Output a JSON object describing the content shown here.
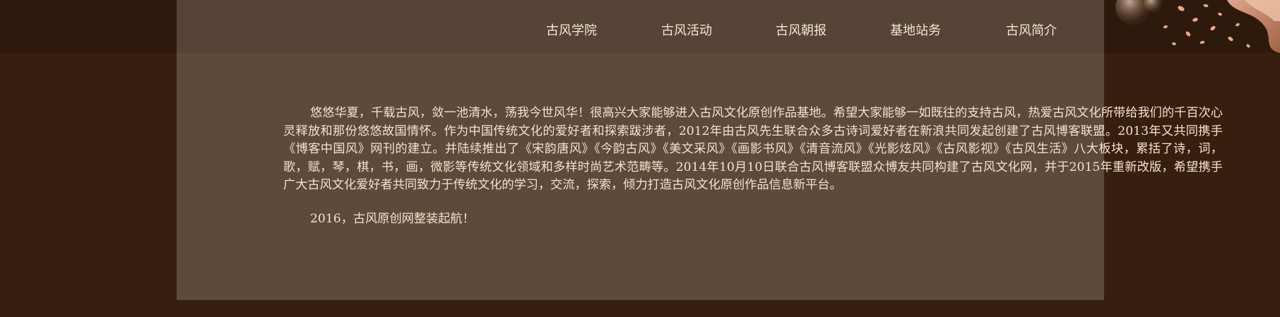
{
  "nav": {
    "items": [
      {
        "label": "古风学院"
      },
      {
        "label": "古风活动"
      },
      {
        "label": "古风朝报"
      },
      {
        "label": "基地站务"
      },
      {
        "label": "古风简介"
      }
    ]
  },
  "intro": {
    "paragraph_1": "悠悠华夏，千载古风，敛一池清水，荡我今世风华！很高兴大家能够进入古风文化原创作品基地。希望大家能够一如既往的支持古风，热爱古风文化所带给我们的千百次心灵释放和那份悠悠故国情怀。作为中国传统文化的爱好者和探索跋涉者，2012年由古风先生联合众多古诗词爱好者在新浪共同发起创建了古风博客联盟。2013年又共同携手《博客中国风》网刊的建立。并陆续推出了《宋韵唐风》《今韵古风》《美文采风》《画影书风》《清音流风》《光影炫风》《古风影视》《古风生活》八大板块，累括了诗，词，歌，赋，琴，棋，书，画，微影等传统文化领域和多样时尚艺术范畴等。2014年10月10日联合古风博客联盟众博友共同构建了古风文化网，并于2015年重新改版，希望携手广大古风文化爱好者共同致力于传统文化的学习，交流，探索，倾力打造古风文化原创作品信息新平台。",
    "paragraph_2": "2016，古风原创网整装起航！"
  },
  "colors": {
    "background": "#371f10",
    "panel": "#5d4a3b",
    "text": "#f3e3c9",
    "accent": "#e0a080"
  }
}
